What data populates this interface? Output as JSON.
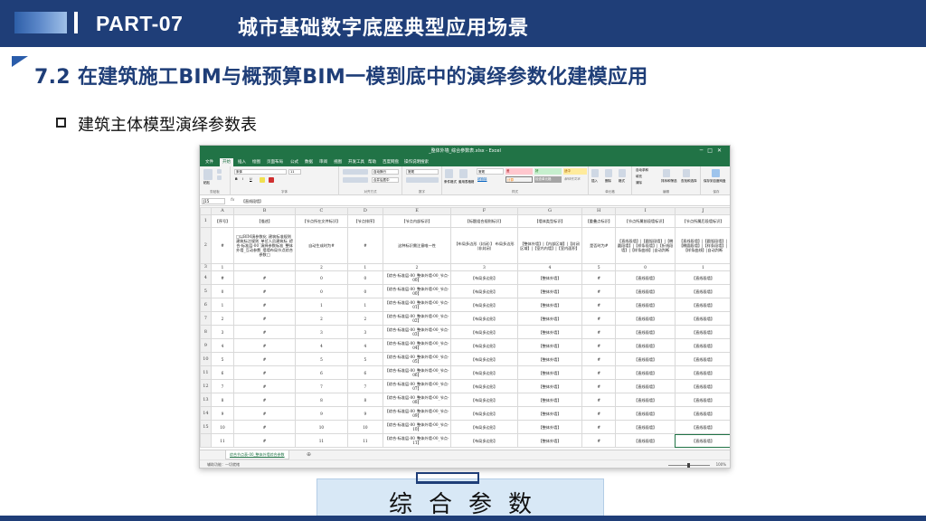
{
  "slide": {
    "part": "PART-07",
    "header_title": "城市基础数字底座典型应用场景",
    "section_title": "7.2 在建筑施工BIM与概预算BIM一模到底中的演绎参数化建模应用",
    "bullet": "建筑主体模型演绎参数表",
    "caption": "综合参数"
  },
  "colors": {
    "primary": "#1f3e78",
    "excel_green": "#217346",
    "caption_bg": "#d8e8f6"
  },
  "excel": {
    "window_title": "_整体外墙_综合参数表.xlsx - Excel",
    "tabs": [
      "文件",
      "开始",
      "插入",
      "绘图",
      "页面布局",
      "公式",
      "数据",
      "审阅",
      "视图",
      "开发工具",
      "帮助",
      "百度网盘",
      "操作说明搜索"
    ],
    "active_tab": "开始",
    "ribbon": {
      "groups": [
        "剪贴板",
        "字体",
        "对齐方式",
        "数字",
        "样式",
        "单元格",
        "编辑",
        "保存"
      ],
      "font_name": "宋体",
      "font_size": "11",
      "number_format": "常规",
      "styles": [
        "常规",
        "差",
        "好",
        "适中",
        "超链接",
        "计算",
        "检查单元格",
        "解释性文本"
      ],
      "wrap": "自动换行",
      "merge": "合并后居中",
      "paste": "粘贴",
      "conditional": "条件格式",
      "table_format": "套用表格格式",
      "insert": "插入",
      "delete": "删除",
      "format": "格式",
      "autosum": "自动求和",
      "fill": "填充",
      "clear": "清除",
      "sort": "排序和筛选",
      "find": "查找和选择",
      "save_baidu": "保存到百度网盘"
    },
    "name_box": "J15",
    "formula": "【直线段墙】",
    "columns": [
      "A",
      "B",
      "C",
      "D",
      "E",
      "F",
      "G",
      "H",
      "I",
      "J"
    ],
    "header_row": [
      "【序号】",
      "【描述】",
      "【节点所在文件标识】",
      "【节点排序】",
      "【节点内部标识】",
      "【标题组合规则标识】",
      "【墙体类型标识】",
      "【重叠点标识】",
      "【节点所属前段墙标识】",
      "【节点所属后段墙标识】"
    ],
    "row2": [
      "#",
      "□以BIM演参数化_建筑标准规则_建筑标注规则_单位人员建筑标_综合-标准层-00_演绎参数标准_整体外墙_互动参数_墙墙布局节点综合参数□",
      "自动生成时为#",
      "#",
      "这种标识需注意唯一性",
      "【布局多边形（封闭）】 布局多边形（非封闭）",
      "【整体外墙】|【内部区域】|【封闭区域】|【室内内墙】|【室内面积】",
      "是否时为#",
      "【直线段墙】|【圆弧段墙】|【椭圆段墙】|【样条段墙】|【折线段墙】|【样条曲线】|自动判断",
      "【直线段墙】|【圆弧段墙】|【椭圆段墙】|【样条段墙】|【样条曲线】|自动判断"
    ],
    "row3": [
      "1",
      "",
      "2",
      "1",
      "2",
      "3",
      "4",
      "5",
      "0",
      "1"
    ],
    "row_numbers": [
      "1",
      "2",
      "3",
      "4",
      "5",
      "6",
      "7",
      "8",
      "9",
      "10",
      "11",
      "12",
      "13",
      "14",
      "15"
    ],
    "data_rows": [
      [
        "#",
        "#",
        "0",
        "0",
        "【综合-标准层-00_整体外墙-00_节点-00】",
        "【布局多边形】",
        "【整体外墙】",
        "#",
        "【直线段墙】",
        "【直线段墙】"
      ],
      [
        "0",
        "#",
        "0",
        "0",
        "【综合-标准层-00_整体外墙-00_节点-00】",
        "【布局多边形】",
        "【整体外墙】",
        "#",
        "【直线段墙】",
        "【直线段墙】"
      ],
      [
        "1",
        "#",
        "1",
        "1",
        "【综合-标准层-00_整体外墙-00_节点-01】",
        "【布局多边形】",
        "【整体外墙】",
        "#",
        "【直线段墙】",
        "【直线段墙】"
      ],
      [
        "2",
        "#",
        "2",
        "2",
        "【综合-标准层-00_整体外墙-00_节点-02】",
        "【布局多边形】",
        "【整体外墙】",
        "#",
        "【直线段墙】",
        "【直线段墙】"
      ],
      [
        "3",
        "#",
        "3",
        "3",
        "【综合-标准层-00_整体外墙-00_节点-03】",
        "【布局多边形】",
        "【整体外墙】",
        "#",
        "【直线段墙】",
        "【直线段墙】"
      ],
      [
        "4",
        "#",
        "4",
        "4",
        "【综合-标准层-00_整体外墙-00_节点-04】",
        "【布局多边形】",
        "【整体外墙】",
        "#",
        "【直线段墙】",
        "【直线段墙】"
      ],
      [
        "5",
        "#",
        "5",
        "5",
        "【综合-标准层-00_整体外墙-00_节点-05】",
        "【布局多边形】",
        "【整体外墙】",
        "#",
        "【直线段墙】",
        "【直线段墙】"
      ],
      [
        "6",
        "#",
        "6",
        "6",
        "【综合-标准层-00_整体外墙-00_节点-06】",
        "【布局多边形】",
        "【整体外墙】",
        "#",
        "【直线段墙】",
        "【直线段墙】"
      ],
      [
        "7",
        "#",
        "7",
        "7",
        "【综合-标准层-00_整体外墙-00_节点-07】",
        "【布局多边形】",
        "【整体外墙】",
        "#",
        "【直线段墙】",
        "【直线段墙】"
      ],
      [
        "8",
        "#",
        "8",
        "8",
        "【综合-标准层-00_整体外墙-00_节点-08】",
        "【布局多边形】",
        "【整体外墙】",
        "#",
        "【直线段墙】",
        "【直线段墙】"
      ],
      [
        "9",
        "#",
        "9",
        "9",
        "【综合-标准层-00_整体外墙-00_节点-09】",
        "【布局多边形】",
        "【整体外墙】",
        "#",
        "【直线段墙】",
        "【直线段墙】"
      ],
      [
        "10",
        "#",
        "10",
        "10",
        "【综合-标准层-00_整体外墙-00_节点-10】",
        "【布局多边形】",
        "【整体外墙】",
        "#",
        "【直线段墙】",
        "【直线段墙】"
      ],
      [
        "11",
        "#",
        "11",
        "11",
        "【综合-标准层-00_整体外墙-00_节点-11】",
        "【布局多边形】",
        "【整体外墙】",
        "#",
        "【直线段墙】",
        "【直线段墙】"
      ]
    ],
    "sheet_tab": "综合节点表-00_整体外墙综合参数",
    "status": "辅助功能：一切就绪",
    "zoom": "100%"
  }
}
